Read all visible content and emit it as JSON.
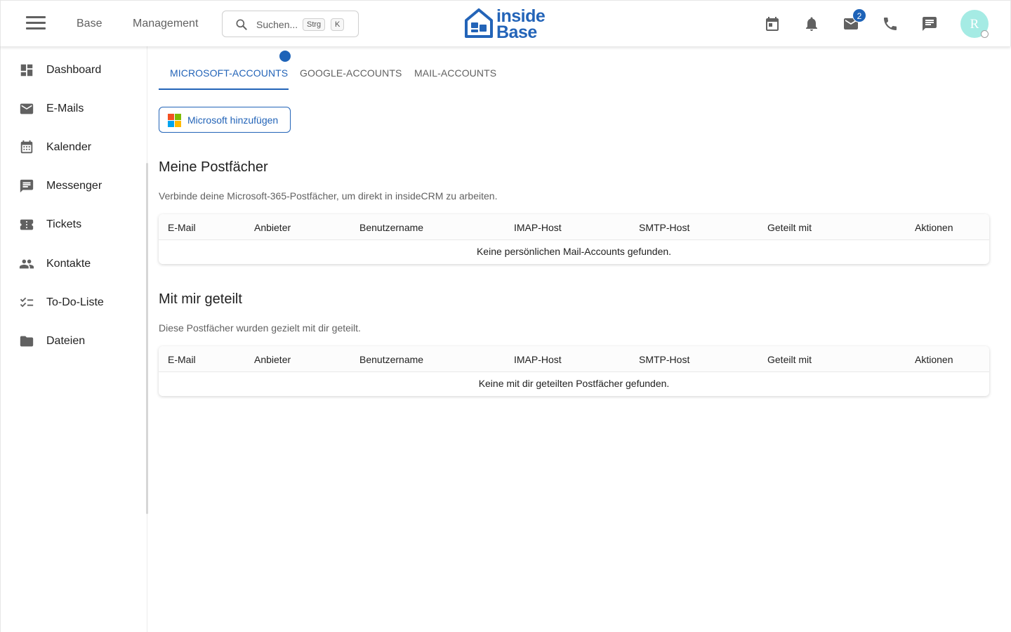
{
  "header": {
    "nav_links": [
      "Base",
      "Management"
    ],
    "search": {
      "placeholder": "Suchen...",
      "shortcut_keys": [
        "Strg",
        "K"
      ]
    },
    "logo": {
      "line1": "inside",
      "line2": "Base"
    },
    "mail_badge_count": "2",
    "avatar_initial": "R",
    "icons": [
      "calendar-icon",
      "bell-icon",
      "mail-icon",
      "phone-icon",
      "chat-icon"
    ]
  },
  "sidebar": {
    "items": [
      {
        "label": "Dashboard",
        "icon": "dashboard-icon"
      },
      {
        "label": "E-Mails",
        "icon": "mail-icon"
      },
      {
        "label": "Kalender",
        "icon": "calendar-icon"
      },
      {
        "label": "Messenger",
        "icon": "message-icon"
      },
      {
        "label": "Tickets",
        "icon": "ticket-icon"
      },
      {
        "label": "Kontakte",
        "icon": "people-icon"
      },
      {
        "label": "To-Do-Liste",
        "icon": "checklist-icon"
      },
      {
        "label": "Dateien",
        "icon": "folder-icon"
      }
    ]
  },
  "tabs": [
    {
      "label": "Microsoft-Accounts",
      "active": true
    },
    {
      "label": "Google-Accounts",
      "active": false
    },
    {
      "label": "Mail-Accounts",
      "active": false
    }
  ],
  "add_button": {
    "label": "Microsoft hinzufügen"
  },
  "sections": [
    {
      "title": "Meine Postfächer",
      "description": "Verbinde deine Microsoft-365-Postfächer, um direkt in insideCRM zu arbeiten.",
      "columns": [
        "E-Mail",
        "Anbieter",
        "Benutzername",
        "IMAP-Host",
        "SMTP-Host",
        "Geteilt mit",
        "Aktionen"
      ],
      "empty_text": "Keine persönlichen Mail-Accounts gefunden."
    },
    {
      "title": "Mit mir geteilt",
      "description": "Diese Postfächer wurden gezielt mit dir geteilt.",
      "columns": [
        "E-Mail",
        "Anbieter",
        "Benutzername",
        "IMAP-Host",
        "SMTP-Host",
        "Geteilt mit",
        "Aktionen"
      ],
      "empty_text": "Keine mit dir geteilten Postfächer gefunden."
    }
  ],
  "colors": {
    "primary": "#2364b8",
    "badge": "#1e63b8",
    "avatar_bg": "#a5ebe4",
    "text_muted": "#616161",
    "icon_gray": "#616161"
  }
}
